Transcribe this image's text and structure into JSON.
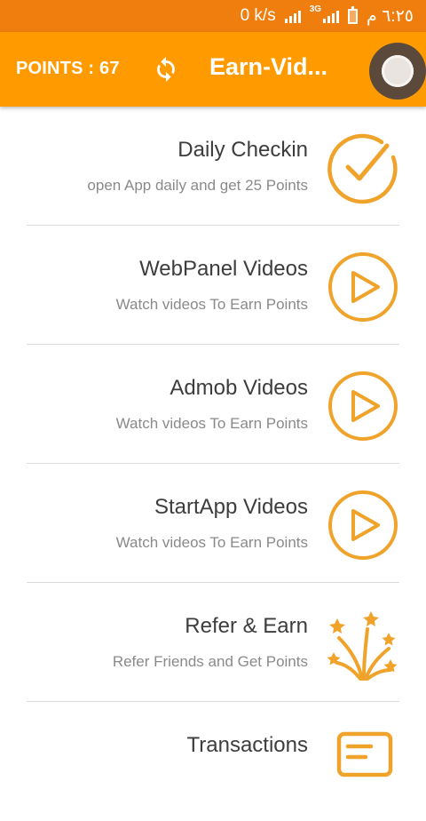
{
  "status_bar": {
    "speed": "0 k/s",
    "network": "3G",
    "time": "٦:٢٥ م"
  },
  "app_bar": {
    "points_label": "POINTS : 67",
    "title": "Earn-Vid..."
  },
  "colors": {
    "status_bar_bg": "#ef7e0f",
    "app_bar_bg": "#ff9a00",
    "accent_icon": "#f0a32a"
  },
  "menu": [
    {
      "title": "Daily Checkin",
      "subtitle": "open App daily and get 25 Points",
      "icon": "checkmark-circle-icon"
    },
    {
      "title": "WebPanel Videos",
      "subtitle": "Watch videos To Earn Points",
      "icon": "play-circle-icon"
    },
    {
      "title": "Admob Videos",
      "subtitle": "Watch videos To Earn Points",
      "icon": "play-circle-icon"
    },
    {
      "title": "StartApp Videos",
      "subtitle": "Watch videos To Earn Points",
      "icon": "play-circle-icon"
    },
    {
      "title": "Refer & Earn",
      "subtitle": "Refer Friends and Get Points",
      "icon": "fireworks-icon"
    },
    {
      "title": "Transactions",
      "subtitle": "",
      "icon": "receipt-icon"
    }
  ]
}
